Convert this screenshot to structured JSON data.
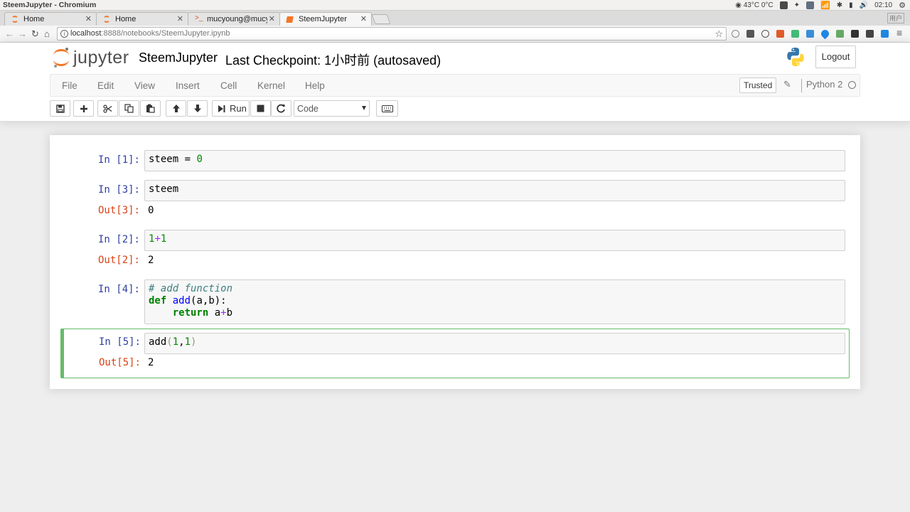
{
  "os": {
    "window_title": "SteemJupyter - Chromium",
    "temperature": "43°C 0°C",
    "clock": "02:10"
  },
  "browser": {
    "tabs": [
      {
        "label": "Home",
        "active": false
      },
      {
        "label": "Home",
        "active": false
      },
      {
        "label": "mucyoung@mucyo",
        "active": false
      },
      {
        "label": "SteemJupyter",
        "active": true
      }
    ],
    "corner_label": "用户",
    "url_host": "localhost",
    "url_path": ":8888/notebooks/SteemJupyter.ipynb"
  },
  "jupyter": {
    "logo_text": "jupyter",
    "notebook_name": "SteemJupyter",
    "checkpoint": "Last Checkpoint: 1小时前  (autosaved)",
    "logout_label": "Logout",
    "menu": [
      "File",
      "Edit",
      "View",
      "Insert",
      "Cell",
      "Kernel",
      "Help"
    ],
    "trusted_label": "Trusted",
    "kernel_name": "Python 2",
    "toolbar": {
      "run_label": "Run",
      "cell_type": "Code"
    }
  },
  "cells": [
    {
      "in_prompt": "In [1]:",
      "code": "steem = 0"
    },
    {
      "in_prompt": "In [3]:",
      "code": "steem",
      "out_prompt": "Out[3]:",
      "output": "0"
    },
    {
      "in_prompt": "In [2]:",
      "code": "1+1",
      "out_prompt": "Out[2]:",
      "output": "2"
    },
    {
      "in_prompt": "In [4]:",
      "code": "# add function\ndef add(a,b):\n    return a+b"
    },
    {
      "in_prompt": "In [5]:",
      "code": "add(1,1)",
      "out_prompt": "Out[5]:",
      "output": "2",
      "selected": true
    }
  ]
}
